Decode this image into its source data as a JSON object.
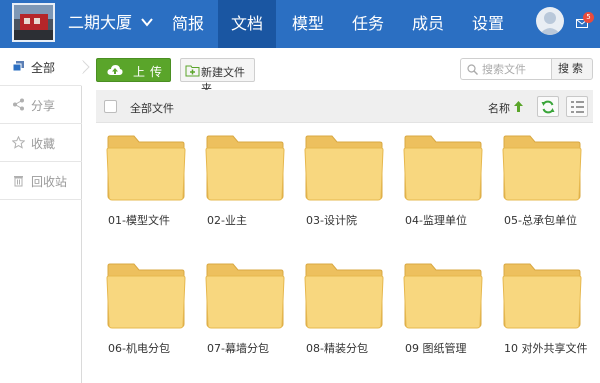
{
  "project": {
    "name": "二期大厦"
  },
  "nav": {
    "items": [
      {
        "label": "简报",
        "active": false
      },
      {
        "label": "文档",
        "active": true
      },
      {
        "label": "模型",
        "active": false
      },
      {
        "label": "任务",
        "active": false
      },
      {
        "label": "成员",
        "active": false
      },
      {
        "label": "设置",
        "active": false
      }
    ]
  },
  "user": {
    "mail_badge": "5"
  },
  "sidebar": {
    "items": [
      {
        "label": "全部",
        "icon": "stack-icon",
        "active": true
      },
      {
        "label": "分享",
        "icon": "share-icon",
        "active": false
      },
      {
        "label": "收藏",
        "icon": "star-icon",
        "active": false
      },
      {
        "label": "回收站",
        "icon": "trash-icon",
        "active": false
      }
    ]
  },
  "toolbar": {
    "upload_label": "上传",
    "new_folder_label": "新建文件夹",
    "search_placeholder": "搜索文件",
    "search_button": "搜索"
  },
  "list": {
    "header_label": "全部文件",
    "sort_label": "名称",
    "sort_direction": "ascending"
  },
  "folders": [
    {
      "name": "01-模型文件"
    },
    {
      "name": "02-业主"
    },
    {
      "name": "03-设计院"
    },
    {
      "name": "04-监理单位"
    },
    {
      "name": "05-总承包单位"
    },
    {
      "name": "06-机电分包"
    },
    {
      "name": "07-幕墙分包"
    },
    {
      "name": "08-精装分包"
    },
    {
      "name": "09 图纸管理"
    },
    {
      "name": "10 对外共享文件"
    }
  ],
  "colors": {
    "topbar": "#2b6fc2",
    "nav_active": "#1a56a2",
    "upload_button": "#5aa52a",
    "folder_fill": "#f8d77f",
    "folder_edge": "#e6b84f",
    "badge": "#e84b3c"
  }
}
